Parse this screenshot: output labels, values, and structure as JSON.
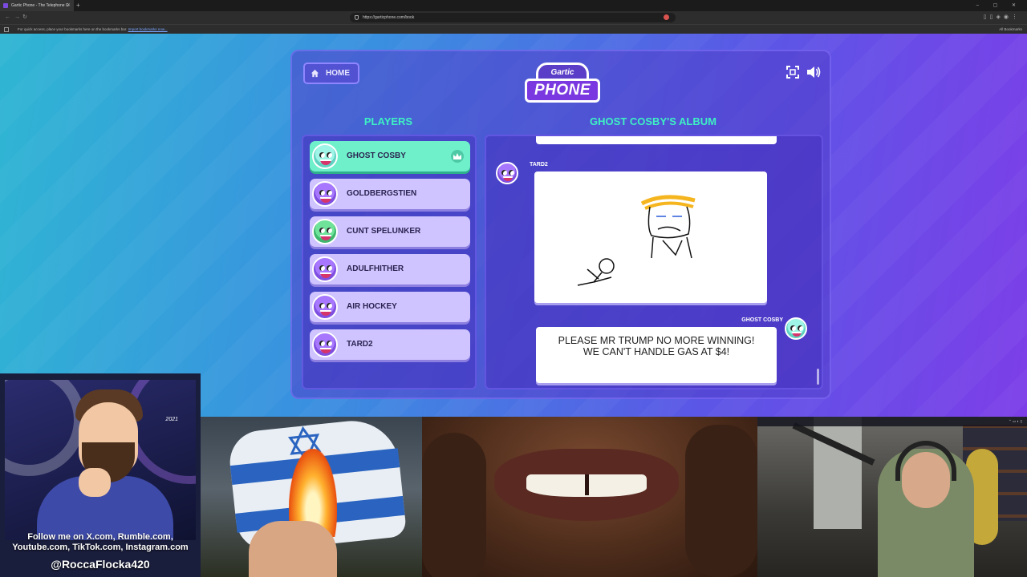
{
  "browser": {
    "tab_title": "Gartic Phone - The Telephone G",
    "url": "https://garticphone.com/book",
    "bookmarks_message": "For quick access, place your bookmarks here on the bookmarks bar.",
    "bookmarks_link": "Import bookmarks now...",
    "all_bookmarks": "All Bookmarks"
  },
  "game": {
    "home_label": "HOME",
    "logo_top": "Gartic",
    "logo_main": "PHONE",
    "players_heading": "PLAYERS",
    "album_heading": "GHOST COSBY'S ALBUM",
    "players": [
      {
        "name": "GHOST COSBY",
        "avatar": "cyan",
        "host": true
      },
      {
        "name": "GOLDBERGSTIEN",
        "avatar": "purple"
      },
      {
        "name": "CUNT SPELUNKER",
        "avatar": "green"
      },
      {
        "name": "ADULFHITHER",
        "avatar": "purple"
      },
      {
        "name": "AIR HOCKEY",
        "avatar": "purple"
      },
      {
        "name": "TARD2",
        "avatar": "purple"
      }
    ],
    "album": {
      "drawing_author": "TARD2",
      "caption_author": "GHOST COSBY",
      "caption": "PLEASE MR TRUMP NO MORE WINNING! WE CAN'T HANDLE GAS AT $4!"
    },
    "colors": {
      "accent_heading": "#3ef0c4",
      "host_row": "#6ff0cb",
      "player_row": "#cfc4ff"
    }
  },
  "overlay": {
    "follow_text": "Follow me on X.com, Rumble.com, Youtube.com, TikTok.com, Instagram.com",
    "handle": "@RoccaFlocka420",
    "art_signature": "2021"
  },
  "icons": [
    "home-icon",
    "fullscreen-icon",
    "sound-icon",
    "crown-icon"
  ]
}
